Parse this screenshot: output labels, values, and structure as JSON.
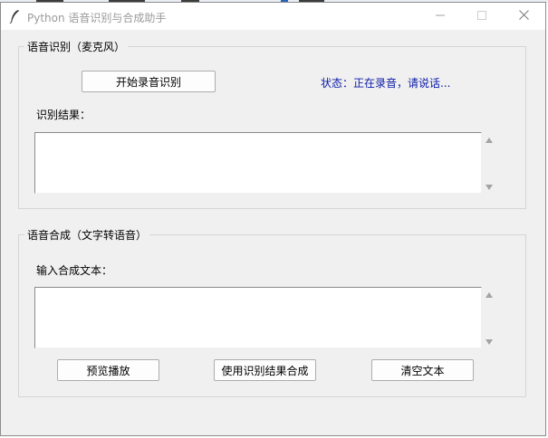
{
  "window": {
    "title": "Python 语音识别与合成助手",
    "controls": {
      "minimize": "—",
      "maximize": "☐",
      "close": "✕"
    }
  },
  "recognition": {
    "group_title": "语音识别（麦克风）",
    "start_button": "开始录音识别",
    "status": "状态：正在录音，请说话...",
    "result_label": "识别结果：",
    "result_text": ""
  },
  "synthesis": {
    "group_title": "语音合成（文字转语音）",
    "input_label": "输入合成文本：",
    "input_text": "",
    "preview_button": "预览播放",
    "use_result_button": "使用识别结果合成",
    "clear_button": "清空文本"
  },
  "colors": {
    "window_bg": "#f0f0f0",
    "status_text": "#0a1aa8",
    "title_text": "#9a9a9a"
  }
}
